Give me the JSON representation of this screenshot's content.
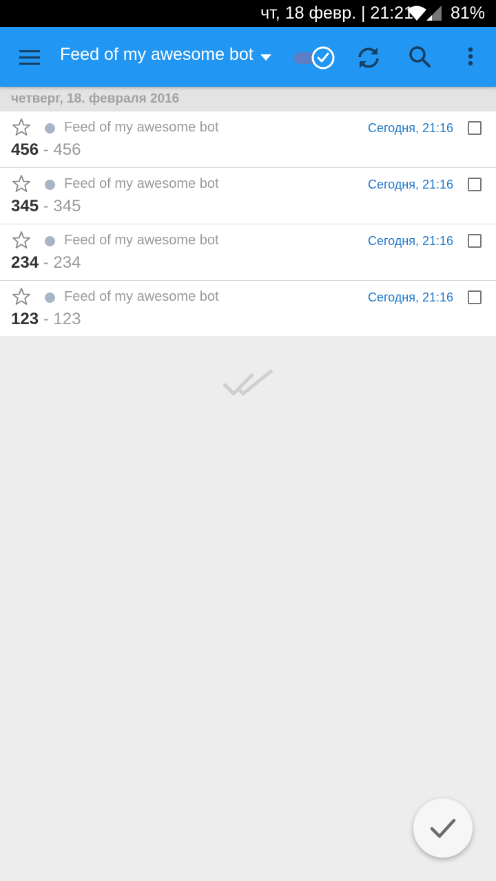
{
  "status_bar": {
    "datetime": "чт, 18 февр. | 21:21",
    "battery": "81%"
  },
  "toolbar": {
    "title": "Feed of my awesome bot",
    "icons": {
      "menu": "hamburger-menu-icon",
      "title_caret": "caret-down-icon",
      "toggle": "unread-filter-toggle-icon",
      "refresh": "refresh-icon",
      "search": "search-icon",
      "more": "more-vert-icon"
    }
  },
  "date_header": "четверг, 18. февраля 2016",
  "items": [
    {
      "feed": "Feed of my awesome bot",
      "time": "Сегодня, 21:16",
      "title": "456",
      "separator": "-",
      "description": "456"
    },
    {
      "feed": "Feed of my awesome bot",
      "time": "Сегодня, 21:16",
      "title": "345",
      "separator": "-",
      "description": "345"
    },
    {
      "feed": "Feed of my awesome bot",
      "time": "Сегодня, 21:16",
      "title": "234",
      "separator": "-",
      "description": "234"
    },
    {
      "feed": "Feed of my awesome bot",
      "time": "Сегодня, 21:16",
      "title": "123",
      "separator": "-",
      "description": "123"
    }
  ],
  "colors": {
    "toolbar": "#2196f3",
    "time_text": "#1f78c8",
    "unread_dot": "#a8b4c8",
    "background": "#ededed"
  },
  "fab": {
    "icon": "check-icon"
  },
  "empty_state_icon": "done-all-icon"
}
